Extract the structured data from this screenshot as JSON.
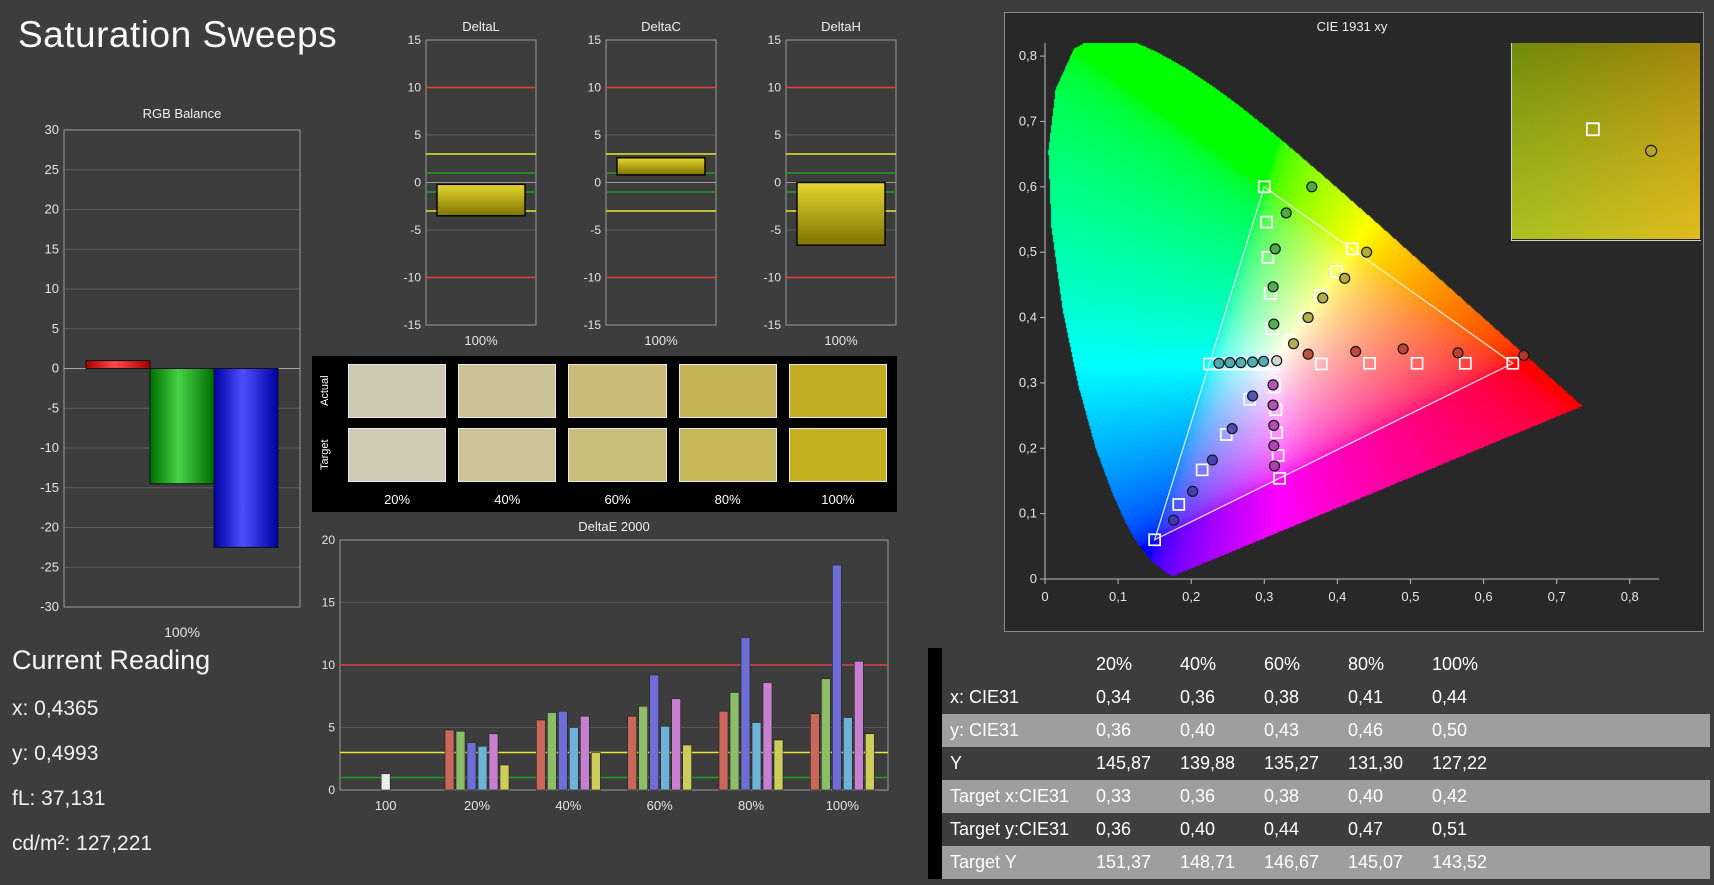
{
  "page": {
    "title": "Saturation Sweeps"
  },
  "current_reading": {
    "title": "Current Reading",
    "lines": [
      "x: 0,4365",
      "y: 0,4993",
      "fL: 37,131",
      "cd/m²: 127,221"
    ]
  },
  "swatches": {
    "row_labels": [
      "Actual",
      "Target"
    ],
    "col_labels": [
      "20%",
      "40%",
      "60%",
      "80%",
      "100%"
    ],
    "actual": [
      "#cdc8b2",
      "#cbc295",
      "#c8bb78",
      "#c4b455",
      "#c0ad20"
    ],
    "target": [
      "#cfcab3",
      "#cdc496",
      "#c9be79",
      "#c6b756",
      "#c2b01c"
    ]
  },
  "table": {
    "col_headers": [
      "20%",
      "40%",
      "60%",
      "80%",
      "100%"
    ],
    "rows": [
      {
        "label": "x: CIE31",
        "values": [
          "0,34",
          "0,36",
          "0,38",
          "0,41",
          "0,44"
        ],
        "shade": "dark"
      },
      {
        "label": "y: CIE31",
        "values": [
          "0,36",
          "0,40",
          "0,43",
          "0,46",
          "0,50"
        ],
        "shade": "light"
      },
      {
        "label": "Y",
        "values": [
          "145,87",
          "139,88",
          "135,27",
          "131,30",
          "127,22"
        ],
        "shade": "dark"
      },
      {
        "label": "Target x:CIE31",
        "values": [
          "0,33",
          "0,36",
          "0,38",
          "0,40",
          "0,42"
        ],
        "shade": "light"
      },
      {
        "label": "Target y:CIE31",
        "values": [
          "0,36",
          "0,40",
          "0,44",
          "0,47",
          "0,51"
        ],
        "shade": "dark"
      },
      {
        "label": "Target Y",
        "values": [
          "151,37",
          "148,71",
          "146,67",
          "145,07",
          "143,52"
        ],
        "shade": "light"
      }
    ]
  },
  "chart_data": [
    {
      "id": "rgb_balance",
      "type": "bar",
      "title": "RGB Balance",
      "xlabel": "100%",
      "categories": [
        "Red",
        "Green",
        "Blue"
      ],
      "values": [
        1.0,
        -14.5,
        -22.5
      ],
      "colors": [
        "#e02020",
        "#1faa1f",
        "#2525e0"
      ],
      "ylim": [
        -30,
        30
      ],
      "yticks": [
        30,
        25,
        20,
        15,
        10,
        5,
        0,
        -5,
        -10,
        -15,
        -20,
        -25,
        -30
      ]
    },
    {
      "id": "deltaL",
      "type": "bar",
      "title": "DeltaL",
      "xlabel": "100%",
      "ylim": [
        -15,
        15
      ],
      "yticks": [
        15,
        10,
        5,
        0,
        -5,
        -10,
        -15
      ],
      "bar_span": [
        -0.2,
        -3.5
      ],
      "value": -3.5,
      "bar_color": "#c6b912",
      "ref_lines": [
        {
          "y": 10,
          "color": "#e04040"
        },
        {
          "y": -10,
          "color": "#e04040"
        },
        {
          "y": 3,
          "color": "#e8e830"
        },
        {
          "y": -3,
          "color": "#e8e830"
        },
        {
          "y": 1,
          "color": "#1f9f1f"
        },
        {
          "y": -1,
          "color": "#1f9f1f"
        }
      ]
    },
    {
      "id": "deltaC",
      "type": "bar",
      "title": "DeltaC",
      "xlabel": "100%",
      "ylim": [
        -15,
        15
      ],
      "yticks": [
        15,
        10,
        5,
        0,
        -5,
        -10,
        -15
      ],
      "bar_span": [
        0.8,
        2.6
      ],
      "value": 2.6,
      "bar_color": "#c6b912",
      "ref_lines": [
        {
          "y": 10,
          "color": "#e04040"
        },
        {
          "y": -10,
          "color": "#e04040"
        },
        {
          "y": 3,
          "color": "#e8e830"
        },
        {
          "y": -3,
          "color": "#e8e830"
        },
        {
          "y": 1,
          "color": "#1f9f1f"
        },
        {
          "y": -1,
          "color": "#1f9f1f"
        }
      ]
    },
    {
      "id": "deltaH",
      "type": "bar",
      "title": "DeltaH",
      "xlabel": "100%",
      "ylim": [
        -15,
        15
      ],
      "yticks": [
        15,
        10,
        5,
        0,
        -5,
        -10,
        -15
      ],
      "bar_span": [
        0,
        -6.6
      ],
      "value": -6.6,
      "bar_color": "#c6b912",
      "ref_lines": [
        {
          "y": 10,
          "color": "#e04040"
        },
        {
          "y": -10,
          "color": "#e04040"
        },
        {
          "y": 3,
          "color": "#e8e830"
        },
        {
          "y": -3,
          "color": "#e8e830"
        },
        {
          "y": 1,
          "color": "#1f9f1f"
        },
        {
          "y": -1,
          "color": "#1f9f1f"
        }
      ]
    },
    {
      "id": "deltaE2000",
      "type": "bar",
      "title": "DeltaE 2000",
      "ylim": [
        0,
        20
      ],
      "yticks": [
        0,
        5,
        10,
        15,
        20
      ],
      "ref_lines": [
        {
          "y": 10,
          "color": "#e04040"
        },
        {
          "y": 3,
          "color": "#e8e830"
        },
        {
          "y": 1,
          "color": "#1f9f1f"
        }
      ],
      "series_order": [
        "red",
        "green",
        "blue",
        "cyan",
        "magenta",
        "yellow"
      ],
      "bar_colors": [
        "#c9685a",
        "#8cbd68",
        "#6e6ed6",
        "#6fb2d8",
        "#c77fd0",
        "#cdcd5c"
      ],
      "groups": [
        {
          "label": "100",
          "values": [
            1.3
          ],
          "colors": [
            "#ececec"
          ]
        },
        {
          "label": "20%",
          "values": [
            4.8,
            4.7,
            3.8,
            3.5,
            4.5,
            2.0
          ]
        },
        {
          "label": "40%",
          "values": [
            5.6,
            6.2,
            6.3,
            5.0,
            5.9,
            3.0
          ]
        },
        {
          "label": "60%",
          "values": [
            5.9,
            6.7,
            9.2,
            5.1,
            7.3,
            3.6
          ]
        },
        {
          "label": "80%",
          "values": [
            6.3,
            7.8,
            12.2,
            5.4,
            8.6,
            4.0
          ]
        },
        {
          "label": "100%",
          "values": [
            6.1,
            8.9,
            18.0,
            5.8,
            10.3,
            4.5
          ]
        }
      ]
    },
    {
      "id": "cie",
      "type": "scatter",
      "title": "CIE 1931 xy",
      "xlim": [
        0,
        0.84
      ],
      "ylim": [
        0,
        0.82
      ],
      "xticks": [
        0,
        0.1,
        0.2,
        0.3,
        0.4,
        0.5,
        0.6,
        0.7,
        0.8
      ],
      "yticks": [
        0,
        0.1,
        0.2,
        0.3,
        0.4,
        0.5,
        0.6,
        0.7,
        0.8
      ],
      "xtick_labels": [
        "0",
        "0,1",
        "0,2",
        "0,3",
        "0,4",
        "0,5",
        "0,6",
        "0,7",
        "0,8"
      ],
      "ytick_labels": [
        "0",
        "0,1",
        "0,2",
        "0,3",
        "0,4",
        "0,5",
        "0,6",
        "0,7",
        "0,8"
      ],
      "gamut_triangle": [
        [
          0.64,
          0.33
        ],
        [
          0.3,
          0.6
        ],
        [
          0.15,
          0.06
        ]
      ],
      "white_point": {
        "target": [
          0.313,
          0.329
        ],
        "measured": [
          0.317,
          0.334
        ],
        "color": "#cccccc"
      },
      "spectral_locus": [
        [
          0.1741,
          0.005
        ],
        [
          0.1666,
          0.0089
        ],
        [
          0.1644,
          0.0109
        ],
        [
          0.144,
          0.0297
        ],
        [
          0.1241,
          0.0578
        ],
        [
          0.1096,
          0.0868
        ],
        [
          0.0913,
          0.1327
        ],
        [
          0.0687,
          0.2007
        ],
        [
          0.0454,
          0.295
        ],
        [
          0.0235,
          0.4127
        ],
        [
          0.0082,
          0.5384
        ],
        [
          0.0039,
          0.6548
        ],
        [
          0.0139,
          0.7502
        ],
        [
          0.0389,
          0.812
        ],
        [
          0.0743,
          0.8338
        ],
        [
          0.1142,
          0.8262
        ],
        [
          0.1547,
          0.8059
        ],
        [
          0.1929,
          0.7816
        ],
        [
          0.2296,
          0.7543
        ],
        [
          0.2658,
          0.7243
        ],
        [
          0.3016,
          0.6923
        ],
        [
          0.3373,
          0.6589
        ],
        [
          0.3731,
          0.6245
        ],
        [
          0.4087,
          0.5896
        ],
        [
          0.4441,
          0.5547
        ],
        [
          0.4788,
          0.5202
        ],
        [
          0.5125,
          0.4866
        ],
        [
          0.5448,
          0.4544
        ],
        [
          0.5752,
          0.4242
        ],
        [
          0.6029,
          0.3965
        ],
        [
          0.627,
          0.3725
        ],
        [
          0.6658,
          0.334
        ],
        [
          0.6915,
          0.3083
        ],
        [
          0.719,
          0.2809
        ],
        [
          0.7347,
          0.2653
        ]
      ],
      "series": [
        {
          "name": "red",
          "color": "#b03a30",
          "target": [
            [
              0.378,
              0.329
            ],
            [
              0.444,
              0.33
            ],
            [
              0.509,
              0.33
            ],
            [
              0.575,
              0.33
            ],
            [
              0.64,
              0.33
            ]
          ],
          "measured": [
            [
              0.36,
              0.344
            ],
            [
              0.425,
              0.348
            ],
            [
              0.49,
              0.352
            ],
            [
              0.565,
              0.346
            ],
            [
              0.655,
              0.342
            ]
          ]
        },
        {
          "name": "green",
          "color": "#3f9f3f",
          "target": [
            [
              0.31,
              0.383
            ],
            [
              0.308,
              0.437
            ],
            [
              0.305,
              0.492
            ],
            [
              0.303,
              0.546
            ],
            [
              0.3,
              0.6
            ]
          ],
          "measured": [
            [
              0.313,
              0.39
            ],
            [
              0.312,
              0.447
            ],
            [
              0.315,
              0.505
            ],
            [
              0.33,
              0.56
            ],
            [
              0.365,
              0.6
            ]
          ]
        },
        {
          "name": "blue",
          "color": "#3a3aa8",
          "target": [
            [
              0.28,
              0.275
            ],
            [
              0.248,
              0.221
            ],
            [
              0.215,
              0.167
            ],
            [
              0.183,
              0.114
            ],
            [
              0.15,
              0.06
            ]
          ],
          "measured": [
            [
              0.284,
              0.28
            ],
            [
              0.256,
              0.23
            ],
            [
              0.229,
              0.182
            ],
            [
              0.202,
              0.134
            ],
            [
              0.176,
              0.09
            ]
          ]
        },
        {
          "name": "cyan",
          "color": "#3a9fa8",
          "target": [
            [
              0.295,
              0.329
            ],
            [
              0.278,
              0.329
            ],
            [
              0.26,
              0.329
            ],
            [
              0.243,
              0.329
            ],
            [
              0.225,
              0.329
            ]
          ],
          "measured": [
            [
              0.299,
              0.333
            ],
            [
              0.284,
              0.332
            ],
            [
              0.268,
              0.331
            ],
            [
              0.253,
              0.331
            ],
            [
              0.238,
              0.33
            ]
          ]
        },
        {
          "name": "magenta",
          "color": "#a83aa8",
          "target": [
            [
              0.314,
              0.294
            ],
            [
              0.316,
              0.259
            ],
            [
              0.317,
              0.224
            ],
            [
              0.319,
              0.189
            ],
            [
              0.321,
              0.154
            ]
          ],
          "measured": [
            [
              0.312,
              0.297
            ],
            [
              0.312,
              0.266
            ],
            [
              0.313,
              0.235
            ],
            [
              0.313,
              0.204
            ],
            [
              0.314,
              0.173
            ]
          ]
        },
        {
          "name": "yellow",
          "color": "#a8a03a",
          "target": [
            [
              0.334,
              0.364
            ],
            [
              0.356,
              0.399
            ],
            [
              0.377,
              0.434
            ],
            [
              0.399,
              0.47
            ],
            [
              0.42,
              0.505
            ]
          ],
          "measured": [
            [
              0.34,
              0.36
            ],
            [
              0.36,
              0.4
            ],
            [
              0.38,
              0.43
            ],
            [
              0.41,
              0.46
            ],
            [
              0.44,
              0.5
            ]
          ]
        }
      ],
      "inset": {
        "region": "yellow-100%",
        "square_pos": [
          0.43,
          0.44
        ],
        "circle_pos": [
          0.74,
          0.55
        ]
      }
    }
  ]
}
